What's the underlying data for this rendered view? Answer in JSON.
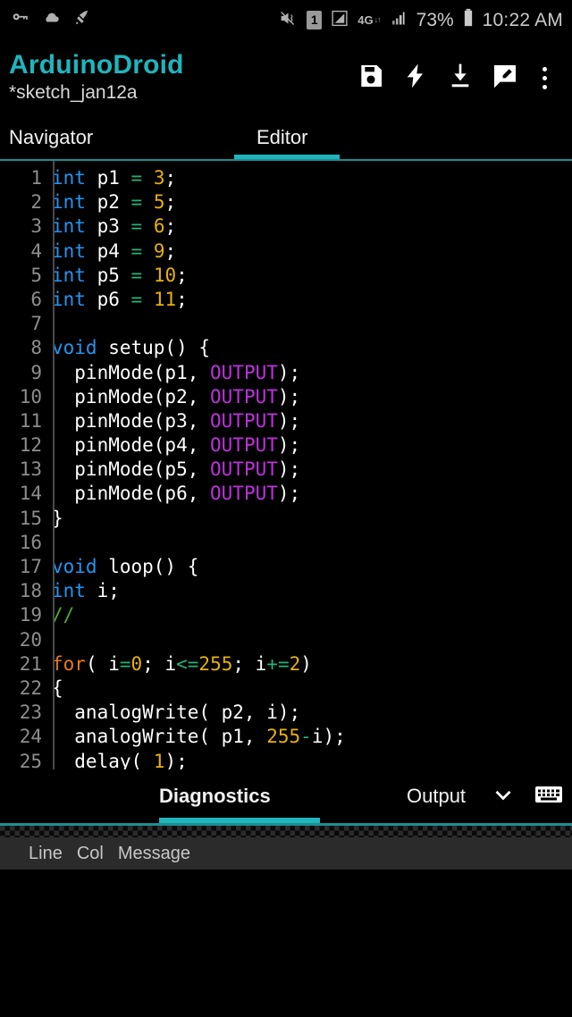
{
  "statusbar": {
    "left_icons": [
      "key-icon",
      "cloud-icon",
      "rocket-icon"
    ],
    "right_icons": [
      "mute-vibrate-icon",
      "sim-card-icon",
      "signal-triangle-icon",
      "network-4g-icon",
      "signal-bars-icon",
      "battery-icon"
    ],
    "sim_label": "1",
    "network_label": "4G",
    "network_arrows": "↓↑",
    "battery_percent": "73%",
    "clock": "10:22 AM"
  },
  "appbar": {
    "title": "ArduinoDroid",
    "subtitle": "*sketch_jan12a",
    "title_color": "#1fb5bd",
    "actions": [
      {
        "name": "save-icon",
        "label": "Save"
      },
      {
        "name": "compile-icon",
        "label": "Compile"
      },
      {
        "name": "upload-icon",
        "label": "Upload"
      },
      {
        "name": "annotate-icon",
        "label": "Annotate"
      },
      {
        "name": "overflow-menu-icon",
        "label": "More options"
      }
    ]
  },
  "tabs": {
    "items": [
      {
        "label": "Navigator",
        "active": false
      },
      {
        "label": "Editor",
        "active": true
      }
    ],
    "accent": "#1fb5bd"
  },
  "editor": {
    "lines": [
      {
        "n": "1",
        "tokens": [
          {
            "t": "int",
            "c": "kw"
          },
          {
            "t": " p1 ",
            "c": "pl"
          },
          {
            "t": "=",
            "c": "op"
          },
          {
            "t": " ",
            "c": "pl"
          },
          {
            "t": "3",
            "c": "num"
          },
          {
            "t": ";",
            "c": "pl"
          }
        ]
      },
      {
        "n": "2",
        "tokens": [
          {
            "t": "int",
            "c": "kw"
          },
          {
            "t": " p2 ",
            "c": "pl"
          },
          {
            "t": "=",
            "c": "op"
          },
          {
            "t": " ",
            "c": "pl"
          },
          {
            "t": "5",
            "c": "num"
          },
          {
            "t": ";",
            "c": "pl"
          }
        ]
      },
      {
        "n": "3",
        "tokens": [
          {
            "t": "int",
            "c": "kw"
          },
          {
            "t": " p3 ",
            "c": "pl"
          },
          {
            "t": "=",
            "c": "op"
          },
          {
            "t": " ",
            "c": "pl"
          },
          {
            "t": "6",
            "c": "num"
          },
          {
            "t": ";",
            "c": "pl"
          }
        ]
      },
      {
        "n": "4",
        "tokens": [
          {
            "t": "int",
            "c": "kw"
          },
          {
            "t": " p4 ",
            "c": "pl"
          },
          {
            "t": "=",
            "c": "op"
          },
          {
            "t": " ",
            "c": "pl"
          },
          {
            "t": "9",
            "c": "num"
          },
          {
            "t": ";",
            "c": "pl"
          }
        ]
      },
      {
        "n": "5",
        "tokens": [
          {
            "t": "int",
            "c": "kw"
          },
          {
            "t": " p5 ",
            "c": "pl"
          },
          {
            "t": "=",
            "c": "op"
          },
          {
            "t": " ",
            "c": "pl"
          },
          {
            "t": "10",
            "c": "num"
          },
          {
            "t": ";",
            "c": "pl"
          }
        ]
      },
      {
        "n": "6",
        "tokens": [
          {
            "t": "int",
            "c": "kw"
          },
          {
            "t": " p6 ",
            "c": "pl"
          },
          {
            "t": "=",
            "c": "op"
          },
          {
            "t": " ",
            "c": "pl"
          },
          {
            "t": "11",
            "c": "num"
          },
          {
            "t": ";",
            "c": "pl"
          }
        ]
      },
      {
        "n": "7",
        "tokens": []
      },
      {
        "n": "8",
        "tokens": [
          {
            "t": "void",
            "c": "kw"
          },
          {
            "t": " setup() {",
            "c": "pl"
          }
        ]
      },
      {
        "n": "9",
        "tokens": [
          {
            "t": "  pinMode(p1, ",
            "c": "pl"
          },
          {
            "t": "OUTPUT",
            "c": "cnst"
          },
          {
            "t": ");",
            "c": "pl"
          }
        ]
      },
      {
        "n": "10",
        "tokens": [
          {
            "t": "  pinMode(p2, ",
            "c": "pl"
          },
          {
            "t": "OUTPUT",
            "c": "cnst"
          },
          {
            "t": ");",
            "c": "pl"
          }
        ]
      },
      {
        "n": "11",
        "tokens": [
          {
            "t": "  pinMode(p3, ",
            "c": "pl"
          },
          {
            "t": "OUTPUT",
            "c": "cnst"
          },
          {
            "t": ");",
            "c": "pl"
          }
        ]
      },
      {
        "n": "12",
        "tokens": [
          {
            "t": "  pinMode(p4, ",
            "c": "pl"
          },
          {
            "t": "OUTPUT",
            "c": "cnst"
          },
          {
            "t": ");",
            "c": "pl"
          }
        ]
      },
      {
        "n": "13",
        "tokens": [
          {
            "t": "  pinMode(p5, ",
            "c": "pl"
          },
          {
            "t": "OUTPUT",
            "c": "cnst"
          },
          {
            "t": ");",
            "c": "pl"
          }
        ]
      },
      {
        "n": "14",
        "tokens": [
          {
            "t": "  pinMode(p6, ",
            "c": "pl"
          },
          {
            "t": "OUTPUT",
            "c": "cnst"
          },
          {
            "t": ");",
            "c": "pl"
          }
        ]
      },
      {
        "n": "15",
        "tokens": [
          {
            "t": "}",
            "c": "pl"
          }
        ]
      },
      {
        "n": "16",
        "tokens": []
      },
      {
        "n": "17",
        "tokens": [
          {
            "t": "void",
            "c": "kw"
          },
          {
            "t": " loop() {",
            "c": "pl"
          }
        ]
      },
      {
        "n": "18",
        "tokens": [
          {
            "t": "int",
            "c": "kw"
          },
          {
            "t": " i;",
            "c": "pl"
          }
        ]
      },
      {
        "n": "19",
        "tokens": [
          {
            "t": "//",
            "c": "cmt"
          }
        ]
      },
      {
        "n": "20",
        "tokens": []
      },
      {
        "n": "21",
        "tokens": [
          {
            "t": "for",
            "c": "kw2"
          },
          {
            "t": "( i",
            "c": "pl"
          },
          {
            "t": "=",
            "c": "op"
          },
          {
            "t": "0",
            "c": "num"
          },
          {
            "t": "; i",
            "c": "pl"
          },
          {
            "t": "<=",
            "c": "op"
          },
          {
            "t": "255",
            "c": "num"
          },
          {
            "t": "; i",
            "c": "pl"
          },
          {
            "t": "+=",
            "c": "op"
          },
          {
            "t": "2",
            "c": "num"
          },
          {
            "t": ")",
            "c": "pl"
          }
        ]
      },
      {
        "n": "22",
        "tokens": [
          {
            "t": "{",
            "c": "pl"
          }
        ]
      },
      {
        "n": "23",
        "tokens": [
          {
            "t": "  analogWrite( p2, i);",
            "c": "pl"
          }
        ]
      },
      {
        "n": "24",
        "tokens": [
          {
            "t": "  analogWrite( p1, ",
            "c": "pl"
          },
          {
            "t": "255",
            "c": "num"
          },
          {
            "t": "-",
            "c": "op"
          },
          {
            "t": "i);",
            "c": "pl"
          }
        ]
      },
      {
        "n": "25",
        "tokens": [
          {
            "t": "  delay( ",
            "c": "pl"
          },
          {
            "t": "1",
            "c": "num"
          },
          {
            "t": ");",
            "c": "pl"
          }
        ]
      }
    ]
  },
  "bottom_panel": {
    "tabs": [
      {
        "label": "Diagnostics",
        "active": true
      },
      {
        "label": "Output",
        "active": false
      }
    ],
    "chevron_icon": "chevron-down-icon",
    "keyboard_icon": "keyboard-icon",
    "diagnostics_columns": [
      "Line",
      "Col",
      "Message"
    ],
    "diagnostics_rows": []
  }
}
